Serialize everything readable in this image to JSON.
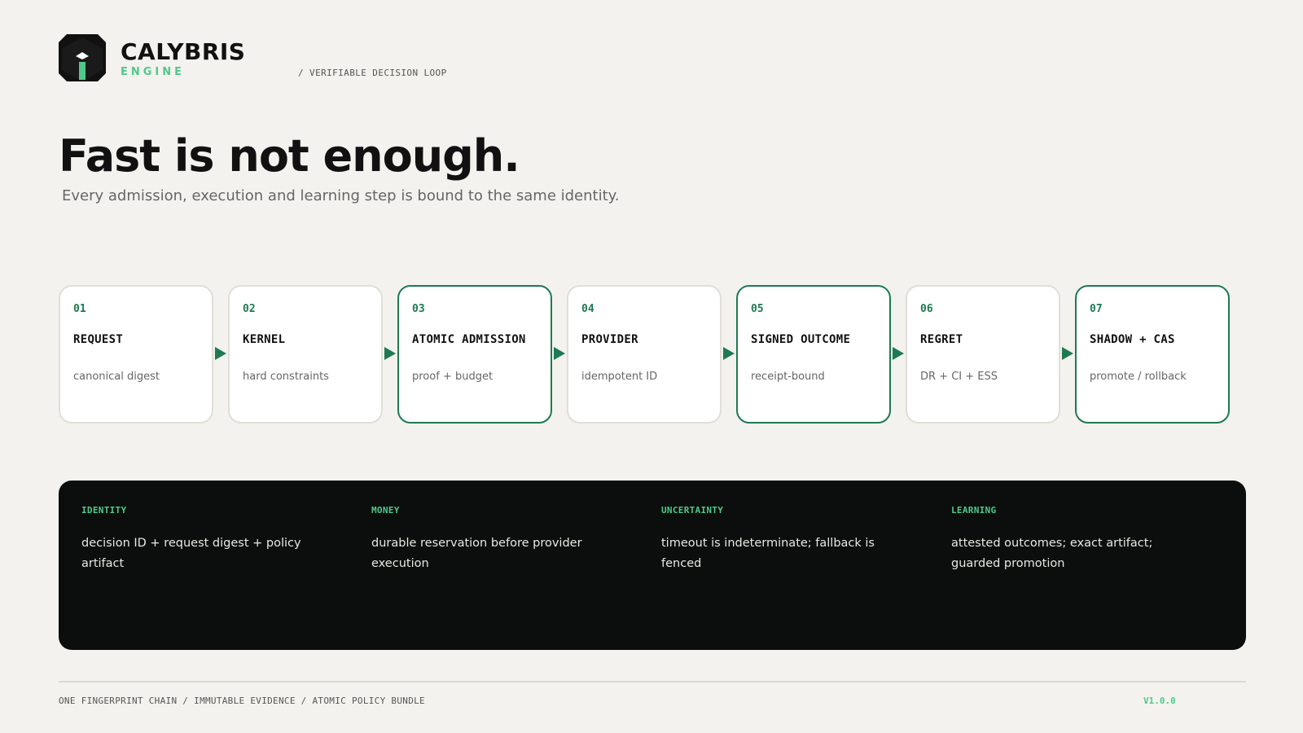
{
  "brand": {
    "name": "CALYBRIS",
    "subtitle": "ENGINE",
    "tagline": "/ VERIFIABLE DECISION LOOP"
  },
  "hero": {
    "headline": "Fast is not enough.",
    "subline": "Every admission, execution and learning step is bound to the same identity."
  },
  "steps": [
    {
      "num": "01",
      "title": "REQUEST",
      "desc": "canonical digest",
      "highlight": false
    },
    {
      "num": "02",
      "title": "KERNEL",
      "desc": "hard constraints",
      "highlight": false
    },
    {
      "num": "03",
      "title": "ATOMIC ADMISSION",
      "desc": "proof + budget",
      "highlight": true
    },
    {
      "num": "04",
      "title": "PROVIDER",
      "desc": "idempotent ID",
      "highlight": false
    },
    {
      "num": "05",
      "title": "SIGNED OUTCOME",
      "desc": "receipt-bound",
      "highlight": true
    },
    {
      "num": "06",
      "title": "REGRET",
      "desc": "DR + CI + ESS",
      "highlight": false
    },
    {
      "num": "07",
      "title": "SHADOW + CAS",
      "desc": "promote / rollback",
      "highlight": true
    }
  ],
  "pillars": [
    {
      "label": "IDENTITY",
      "text": "decision ID + request digest + policy artifact"
    },
    {
      "label": "MONEY",
      "text": "durable reservation before provider execution"
    },
    {
      "label": "UNCERTAINTY",
      "text": "timeout is indeterminate; fallback is fenced"
    },
    {
      "label": "LEARNING",
      "text": "attested outcomes; exact artifact; guarded promotion"
    }
  ],
  "footer": {
    "left": "ONE FINGERPRINT CHAIN / IMMUTABLE EVIDENCE / ATOMIC POLICY BUNDLE",
    "version": "V1.0.0"
  },
  "colors": {
    "accent": "#1e7a52",
    "accent_light": "#4fc98b",
    "background": "#f3f2ee",
    "panel": "#0c0e0d"
  },
  "icons": {
    "logo": "hexagon-logo-icon",
    "flow_arrow": "triangle-right-icon"
  }
}
